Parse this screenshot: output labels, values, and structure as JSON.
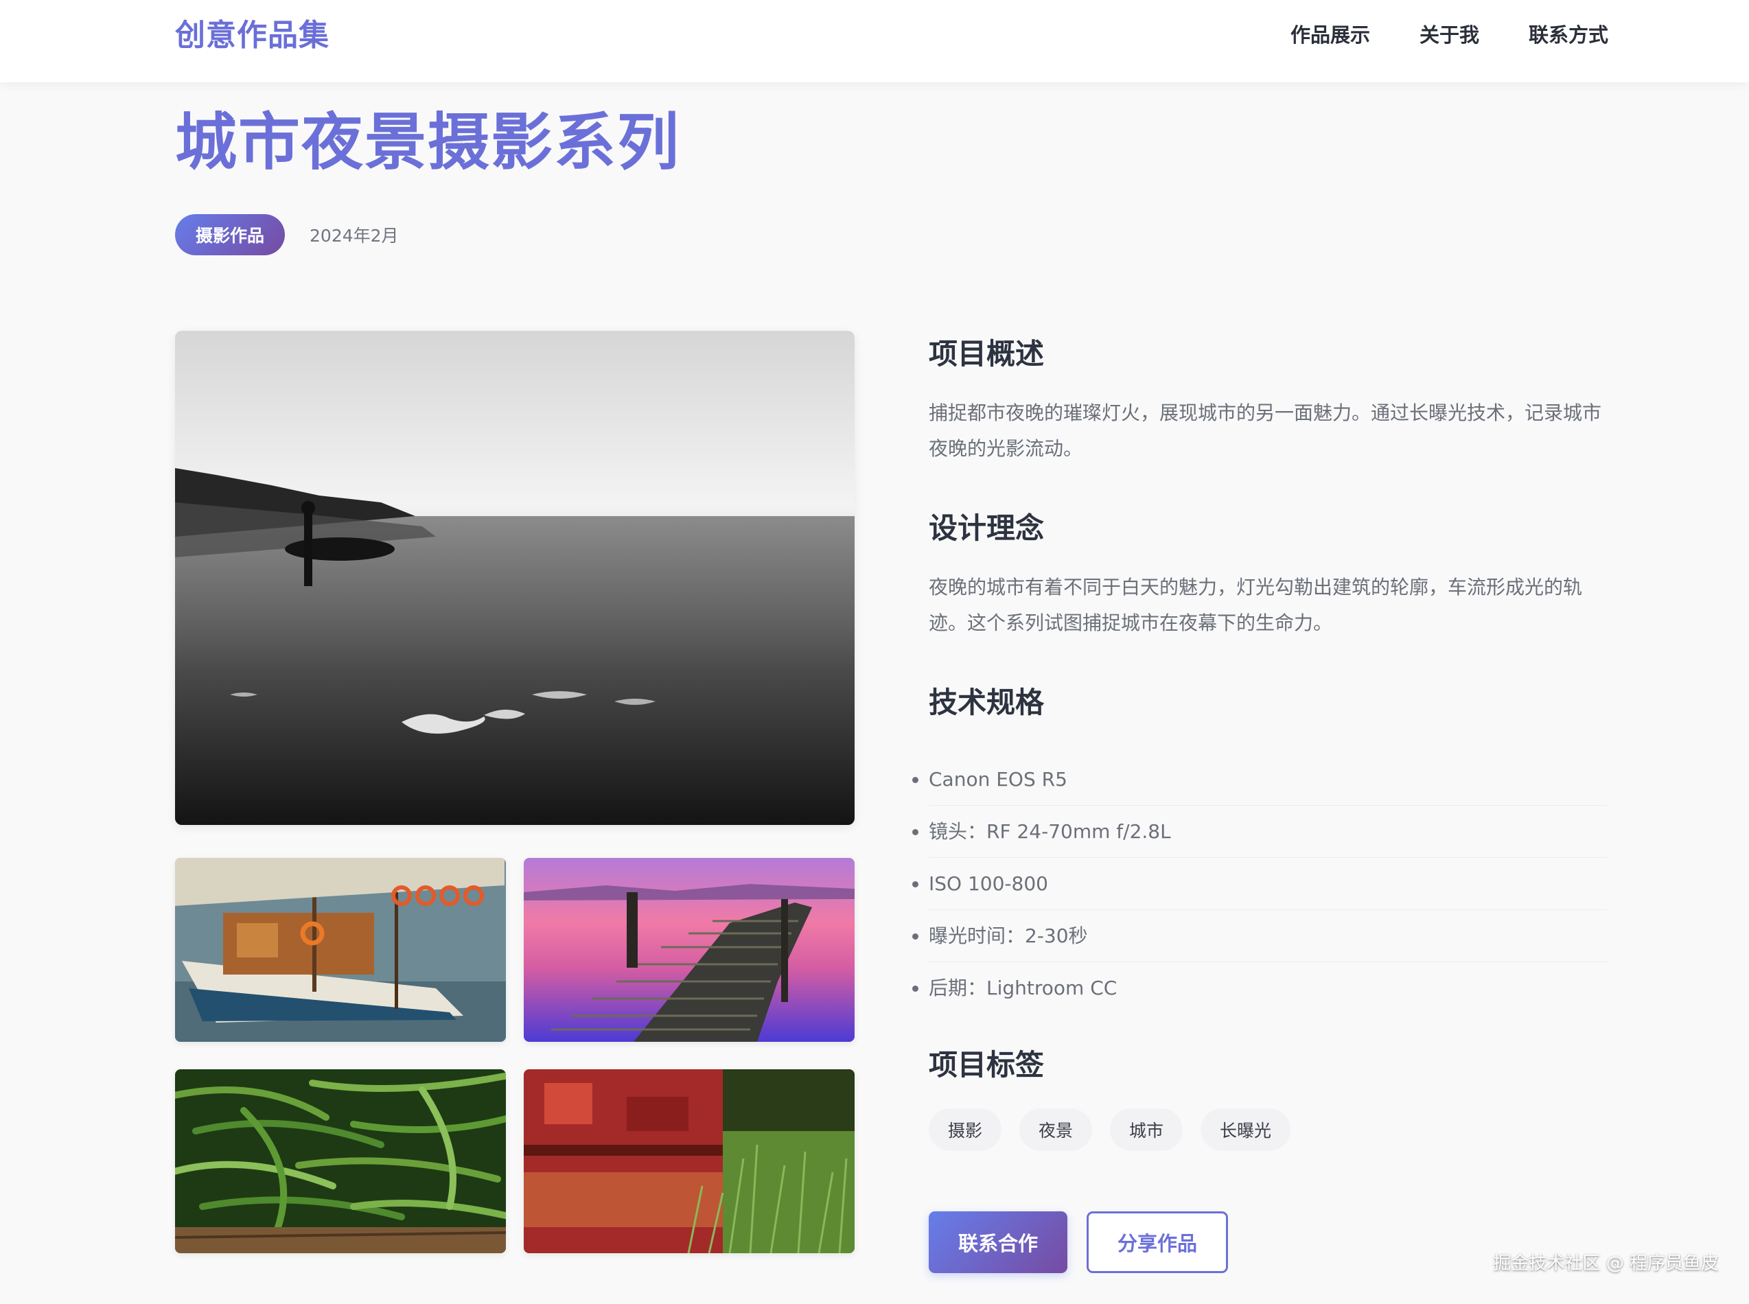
{
  "header": {
    "brand": "创意作品集",
    "nav": [
      "作品展示",
      "关于我",
      "联系方式"
    ]
  },
  "project": {
    "title": "城市夜景摄影系列",
    "category": "摄影作品",
    "date": "2024年2月"
  },
  "gallery": {
    "main": "beach-surfer-photo",
    "thumbnails": [
      "sailboat-photo",
      "pier-sunset-photo",
      "green-beans-photo",
      "rusty-barrel-photo"
    ]
  },
  "details": {
    "overview_title": "项目概述",
    "overview_text": "捕捉都市夜晚的璀璨灯火，展现城市的另一面魅力。通过长曝光技术，记录城市夜晚的光影流动。",
    "concept_title": "设计理念",
    "concept_text": "夜晚的城市有着不同于白天的魅力，灯光勾勒出建筑的轮廓，车流形成光的轨迹。这个系列试图捕捉城市在夜幕下的生命力。",
    "specs_title": "技术规格",
    "specs": [
      "Canon EOS R5",
      "镜头：RF 24-70mm f/2.8L",
      "ISO 100-800",
      "曝光时间：2-30秒",
      "后期：Lightroom CC"
    ],
    "tags_title": "项目标签",
    "tags": [
      "摄影",
      "夜景",
      "城市",
      "长曝光"
    ]
  },
  "actions": {
    "contact": "联系合作",
    "share": "分享作品"
  },
  "watermark": "掘金技术社区 @ 程序员鱼皮",
  "colors": {
    "accent": "#6b70d8",
    "gradient_start": "#667eea",
    "gradient_end": "#764ba2",
    "background": "#f9f9fa"
  }
}
